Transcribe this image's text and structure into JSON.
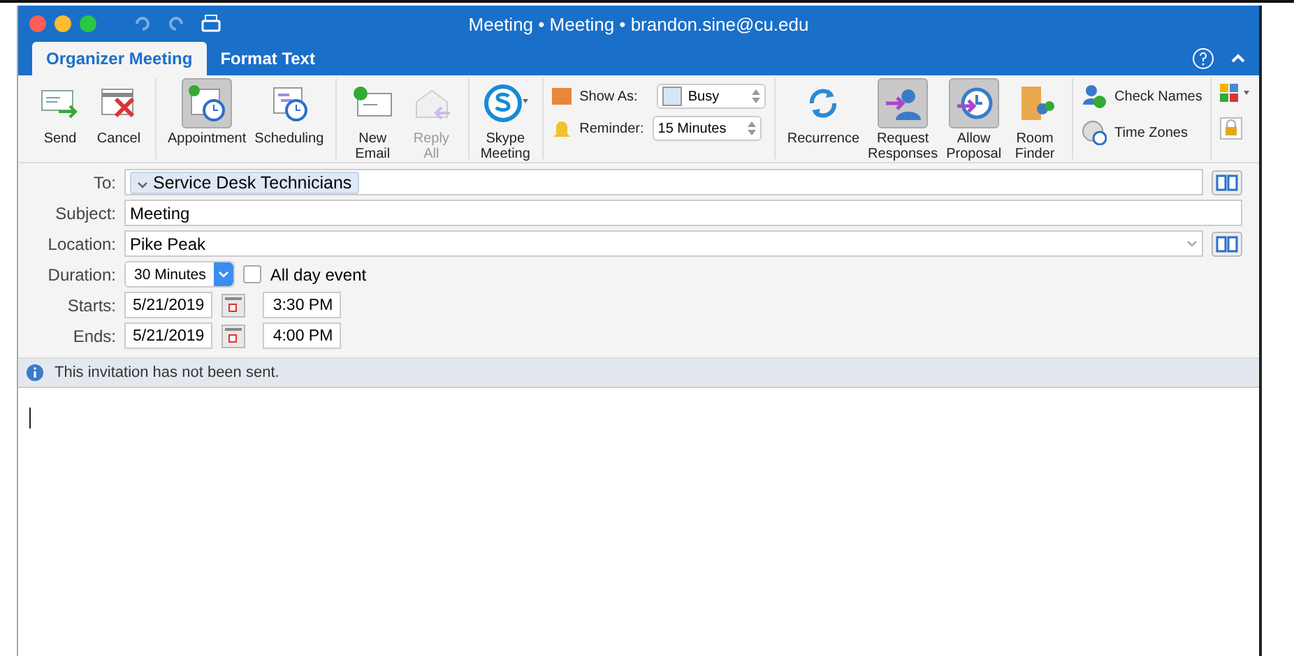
{
  "window": {
    "title": "Meeting • Meeting • brandon.sine@cu.edu"
  },
  "tabs": [
    {
      "label": "Organizer Meeting",
      "selected": true
    },
    {
      "label": "Format Text",
      "selected": false
    }
  ],
  "ribbon": {
    "groups": [
      {
        "buttons": [
          {
            "label": "Send",
            "selected": false,
            "disabled": false
          },
          {
            "label": "Cancel",
            "selected": false,
            "disabled": false
          }
        ]
      },
      {
        "buttons": [
          {
            "label": "Appointment",
            "selected": true,
            "disabled": false
          },
          {
            "label": "Scheduling",
            "selected": false,
            "disabled": false
          }
        ]
      },
      {
        "buttons": [
          {
            "label": "New\nEmail",
            "selected": false,
            "disabled": false
          },
          {
            "label": "Reply\nAll",
            "selected": false,
            "disabled": true
          }
        ]
      },
      {
        "buttons": [
          {
            "label": "Skype\nMeeting",
            "selected": false,
            "disabled": false
          }
        ]
      }
    ],
    "show_as": {
      "label": "Show As:",
      "value": "Busy"
    },
    "reminder": {
      "label": "Reminder:",
      "value": "15 Minutes"
    },
    "options": [
      {
        "label": "Recurrence",
        "selected": false
      },
      {
        "label": "Request\nResponses",
        "selected": true
      },
      {
        "label": "Allow\nProposal",
        "selected": true
      },
      {
        "label": "Room\nFinder",
        "selected": false
      }
    ],
    "names": [
      {
        "label": "Check Names"
      },
      {
        "label": "Time Zones"
      }
    ]
  },
  "form": {
    "to": {
      "label": "To:",
      "recipient": "Service Desk Technicians"
    },
    "subject": {
      "label": "Subject:",
      "value": "Meeting"
    },
    "location": {
      "label": "Location:",
      "value": "Pike Peak"
    },
    "duration": {
      "label": "Duration:",
      "value": "30 Minutes",
      "all_day_label": "All day event",
      "all_day": false
    },
    "starts": {
      "label": "Starts:",
      "date": "5/21/2019",
      "time": "3:30 PM"
    },
    "ends": {
      "label": "Ends:",
      "date": "5/21/2019",
      "time": "4:00 PM"
    }
  },
  "info_bar": {
    "message": "This invitation has not been sent."
  }
}
